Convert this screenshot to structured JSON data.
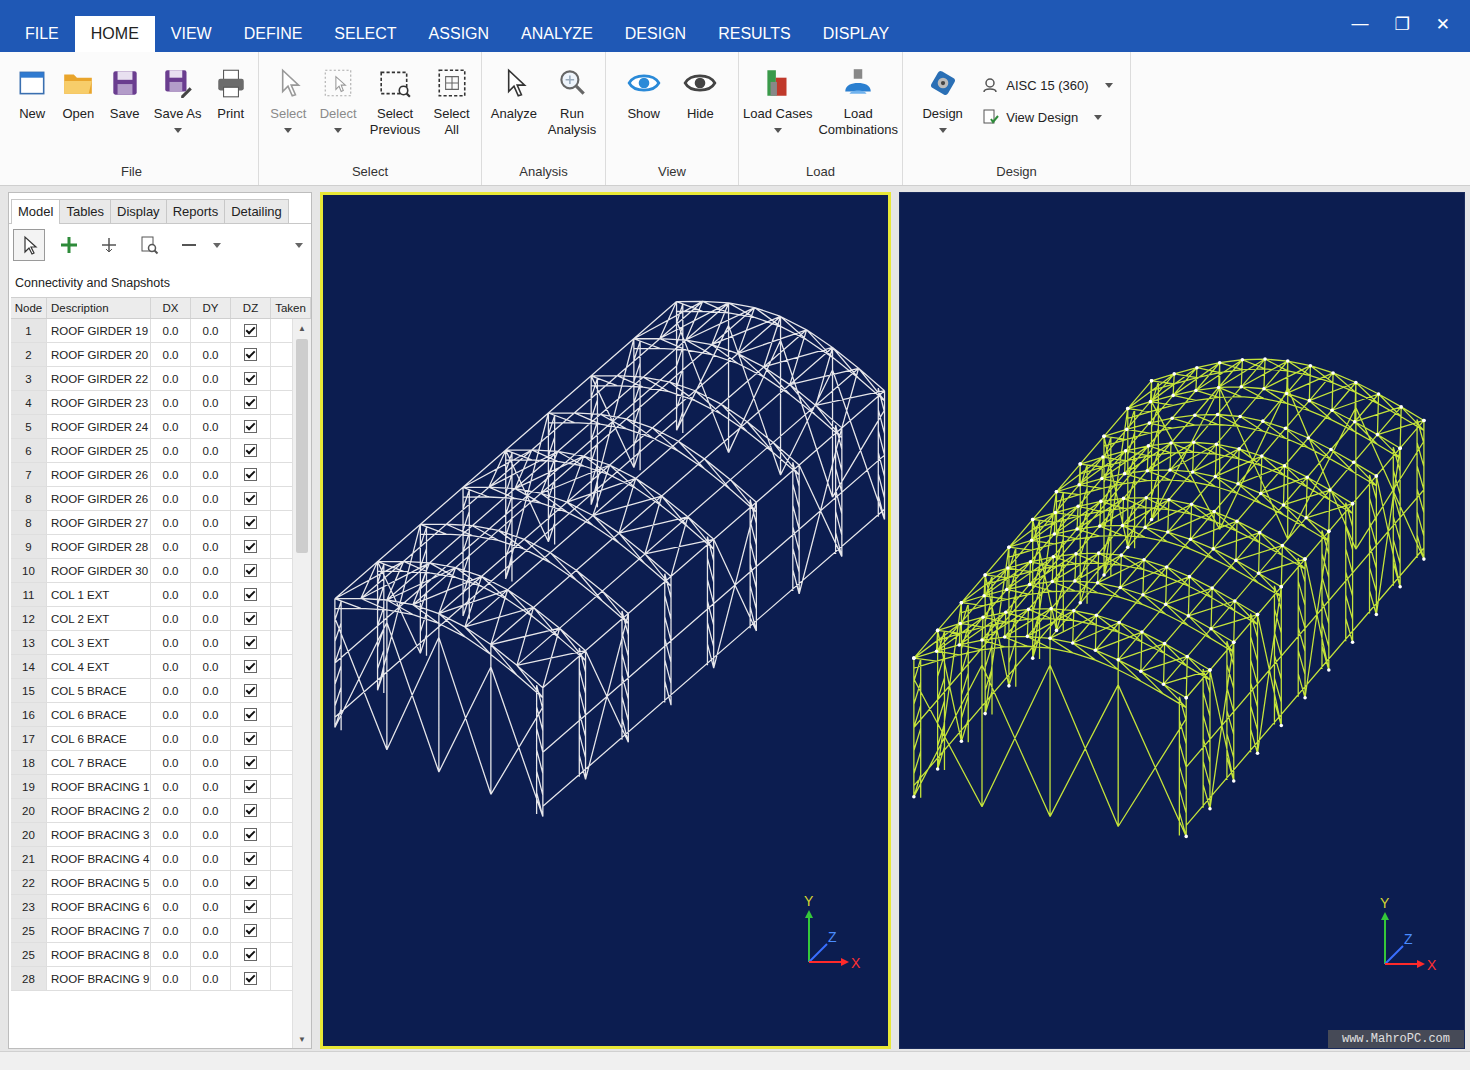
{
  "window": {
    "controls": [
      "—",
      "❐",
      "✕"
    ]
  },
  "menu": [
    {
      "label": "FILE",
      "selected": false
    },
    {
      "label": "HOME",
      "selected": true
    },
    {
      "label": "VIEW",
      "selected": false
    },
    {
      "label": "DEFINE",
      "selected": false
    },
    {
      "label": "SELECT",
      "selected": false
    },
    {
      "label": "ASSIGN",
      "selected": false
    },
    {
      "label": "ANALYZE",
      "selected": false
    },
    {
      "label": "DESIGN",
      "selected": false
    },
    {
      "label": "RESULTS",
      "selected": false
    },
    {
      "label": "DISPLAY",
      "selected": false
    }
  ],
  "ribbon": {
    "groups": [
      {
        "label": "File",
        "buttons": [
          {
            "label": "New",
            "disabled": false,
            "dropdown": false
          },
          {
            "label": "Open",
            "disabled": false,
            "dropdown": false
          },
          {
            "label": "Save",
            "disabled": false,
            "dropdown": false
          },
          {
            "label": "Save As",
            "disabled": false,
            "dropdown": true
          },
          {
            "label": "Print",
            "disabled": false,
            "dropdown": false
          }
        ]
      },
      {
        "label": "Select",
        "buttons": [
          {
            "label": "Select",
            "disabled": true,
            "dropdown": true
          },
          {
            "label": "Delect",
            "disabled": true,
            "dropdown": true
          },
          {
            "label": "Select Previous",
            "disabled": false,
            "dropdown": false
          },
          {
            "label": "Select All",
            "disabled": false,
            "dropdown": false
          }
        ]
      },
      {
        "label": "Analysis",
        "buttons": [
          {
            "label": "Analyze",
            "disabled": false,
            "dropdown": false
          },
          {
            "label": "Run Analysis",
            "disabled": false,
            "dropdown": false
          }
        ]
      },
      {
        "label": "View",
        "buttons": [
          {
            "label": "Show",
            "disabled": false,
            "dropdown": false
          },
          {
            "label": "Hide",
            "disabled": false,
            "dropdown": false
          }
        ]
      },
      {
        "label": "Load",
        "buttons": [
          {
            "label": "Load Cases",
            "disabled": false,
            "dropdown": true
          },
          {
            "label": "Load Combinations",
            "disabled": false,
            "dropdown": false
          }
        ]
      },
      {
        "label": "Design",
        "buttons": [
          {
            "label": "Design",
            "disabled": false,
            "dropdown": true
          }
        ],
        "options": [
          {
            "label": "AISC 15 (360)",
            "dropdown": true
          },
          {
            "label": "View Design",
            "dropdown": true
          }
        ]
      }
    ]
  },
  "panel": {
    "tabs": [
      {
        "label": "Model",
        "selected": true
      },
      {
        "label": "Tables",
        "selected": false
      },
      {
        "label": "Display",
        "selected": false
      },
      {
        "label": "Reports",
        "selected": false
      },
      {
        "label": "Detailing",
        "selected": false
      }
    ],
    "tools": [
      {
        "selected": true
      },
      {
        "selected": false
      },
      {
        "selected": false
      },
      {
        "selected": false
      },
      {
        "selected": false
      }
    ],
    "title": "Connectivity and Snapshots",
    "columns": [
      "Node",
      "Description",
      "DX",
      "DY",
      "DZ",
      "Taken"
    ],
    "rows": [
      {
        "node": "1",
        "description": "ROOF GIRDER 19",
        "dx": "0.0",
        "dy": "0.0",
        "dz": true
      },
      {
        "node": "2",
        "description": "ROOF GIRDER 20",
        "dx": "0.0",
        "dy": "0.0",
        "dz": true
      },
      {
        "node": "3",
        "description": "ROOF GIRDER 22",
        "dx": "0.0",
        "dy": "0.0",
        "dz": true
      },
      {
        "node": "4",
        "description": "ROOF GIRDER 23",
        "dx": "0.0",
        "dy": "0.0",
        "dz": true
      },
      {
        "node": "5",
        "description": "ROOF GIRDER 24",
        "dx": "0.0",
        "dy": "0.0",
        "dz": true
      },
      {
        "node": "6",
        "description": "ROOF GIRDER 25",
        "dx": "0.0",
        "dy": "0.0",
        "dz": true
      },
      {
        "node": "7",
        "description": "ROOF GIRDER 26",
        "dx": "0.0",
        "dy": "0.0",
        "dz": true
      },
      {
        "node": "8",
        "description": "ROOF GIRDER 26",
        "dx": "0.0",
        "dy": "0.0",
        "dz": true
      },
      {
        "node": "8",
        "description": "ROOF GIRDER 27",
        "dx": "0.0",
        "dy": "0.0",
        "dz": true
      },
      {
        "node": "9",
        "description": "ROOF GIRDER 28",
        "dx": "0.0",
        "dy": "0.0",
        "dz": true
      },
      {
        "node": "10",
        "description": "ROOF GIRDER 30",
        "dx": "0.0",
        "dy": "0.0",
        "dz": true
      },
      {
        "node": "11",
        "description": "COL 1 EXT",
        "dx": "0.0",
        "dy": "0.0",
        "dz": true
      },
      {
        "node": "12",
        "description": "COL 2 EXT",
        "dx": "0.0",
        "dy": "0.0",
        "dz": true
      },
      {
        "node": "13",
        "description": "COL 3 EXT",
        "dx": "0.0",
        "dy": "0.0",
        "dz": true
      },
      {
        "node": "14",
        "description": "COL 4 EXT",
        "dx": "0.0",
        "dy": "0.0",
        "dz": true
      },
      {
        "node": "15",
        "description": "COL 5 BRACE",
        "dx": "0.0",
        "dy": "0.0",
        "dz": true
      },
      {
        "node": "16",
        "description": "COL 6 BRACE",
        "dx": "0.0",
        "dy": "0.0",
        "dz": true
      },
      {
        "node": "17",
        "description": "COL 6 BRACE",
        "dx": "0.0",
        "dy": "0.0",
        "dz": true
      },
      {
        "node": "18",
        "description": "COL 7 BRACE",
        "dx": "0.0",
        "dy": "0.0",
        "dz": true
      },
      {
        "node": "19",
        "description": "ROOF BRACING 1",
        "dx": "0.0",
        "dy": "0.0",
        "dz": true
      },
      {
        "node": "20",
        "description": "ROOF BRACING 2",
        "dx": "0.0",
        "dy": "0.0",
        "dz": true
      },
      {
        "node": "20",
        "description": "ROOF BRACING 3",
        "dx": "0.0",
        "dy": "0.0",
        "dz": true
      },
      {
        "node": "21",
        "description": "ROOF BRACING 4",
        "dx": "0.0",
        "dy": "0.0",
        "dz": true
      },
      {
        "node": "22",
        "description": "ROOF BRACING 5",
        "dx": "0.0",
        "dy": "0.0",
        "dz": true
      },
      {
        "node": "23",
        "description": "ROOF BRACING 6",
        "dx": "0.0",
        "dy": "0.0",
        "dz": true
      },
      {
        "node": "25",
        "description": "ROOF BRACING 7",
        "dx": "0.0",
        "dy": "0.0",
        "dz": true
      },
      {
        "node": "25",
        "description": "ROOF BRACING 8",
        "dx": "0.0",
        "dy": "0.0",
        "dz": true
      },
      {
        "node": "28",
        "description": "ROOF BRACING 9",
        "dx": "0.0",
        "dy": "0.0",
        "dz": true
      }
    ],
    "scrollbar": {
      "up": "▲",
      "down": "▼",
      "level": 0.31
    }
  },
  "viewports": [
    {
      "selected": true,
      "color": "#e6e6ea",
      "axes": {
        "y": "Y",
        "z": "Z",
        "x": "X"
      }
    },
    {
      "selected": false,
      "color": "#c4e33a",
      "axes": {
        "y": "Y",
        "z": "Z",
        "x": "X"
      }
    }
  ],
  "watermark": "www.MahroPC.com"
}
